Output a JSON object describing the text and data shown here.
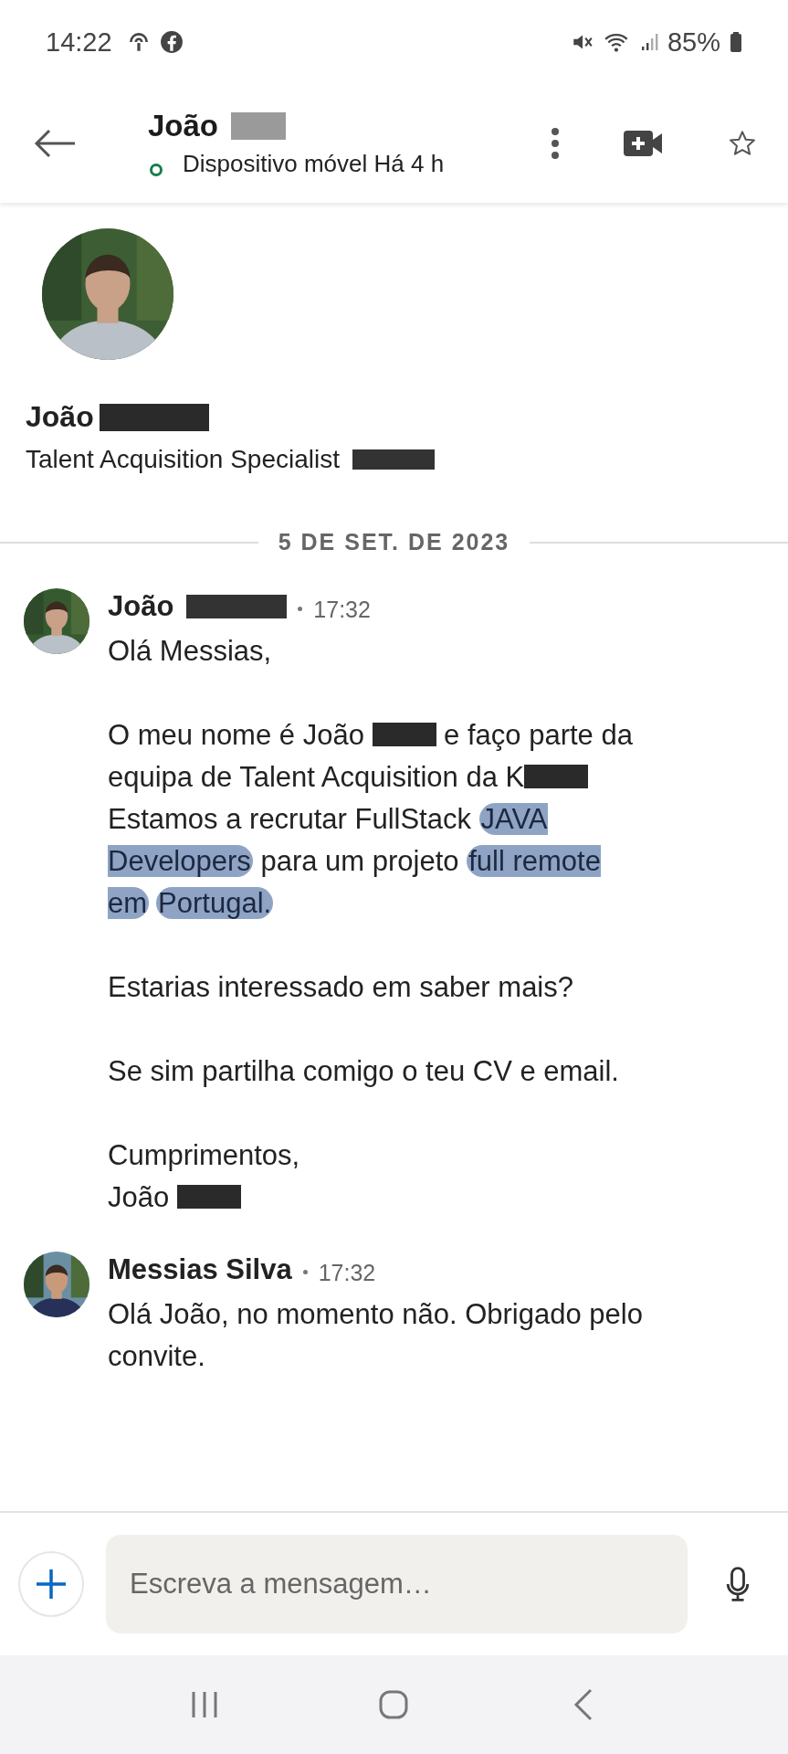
{
  "status_bar": {
    "time": "14:22",
    "battery": "85%"
  },
  "header": {
    "name": "João",
    "name_redacted": true,
    "status": "Dispositivo móvel Há 4 h"
  },
  "profile": {
    "name": "João",
    "name_redacted": true,
    "headline": "Talent Acquisition Specialist",
    "headline_redacted": true
  },
  "date_divider": "5 DE SET. DE 2023",
  "messages": [
    {
      "sender": "João",
      "sender_redacted": true,
      "time": "17:32",
      "paragraphs": [
        [
          {
            "kind": "text",
            "text": "Olá Messias,"
          }
        ],
        [
          {
            "kind": "text",
            "text": "O meu nome é João "
          },
          {
            "kind": "redaction"
          },
          {
            "kind": "text",
            "text": " e faço parte da equipa de Talent Acquisition da K"
          },
          {
            "kind": "redaction"
          },
          {
            "kind": "text",
            "text": " Estamos a recrutar FullStack "
          },
          {
            "kind": "highlight",
            "text": "JAVA Developers"
          },
          {
            "kind": "text",
            "text": " para um projeto "
          },
          {
            "kind": "highlight",
            "text": "full remote em"
          },
          {
            "kind": "highlight",
            "text": "Portugal."
          }
        ],
        [
          {
            "kind": "text",
            "text": "Estarias interessado em saber mais?"
          }
        ],
        [
          {
            "kind": "text",
            "text": "Se sim partilha comigo o teu CV e email."
          }
        ],
        [
          {
            "kind": "text",
            "text": "Cumprimentos,\nJoão "
          },
          {
            "kind": "redaction"
          }
        ]
      ]
    },
    {
      "sender": "Messias Silva",
      "sender_redacted": false,
      "time": "17:32",
      "paragraphs": [
        [
          {
            "kind": "text",
            "text": "Olá João, no momento não. Obrigado pelo convite."
          }
        ]
      ]
    }
  ],
  "composer": {
    "placeholder": "Escreva a mensagem…"
  }
}
